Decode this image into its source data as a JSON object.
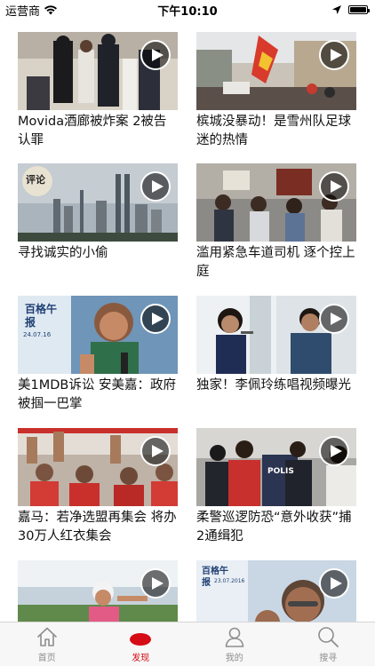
{
  "status_bar": {
    "carrier": "运营商",
    "time": "下午10:10",
    "battery_level": 1.0
  },
  "feed": {
    "items": [
      {
        "title": "Movida酒廊被炸案 2被告认罪",
        "icon": "play-icon"
      },
      {
        "title": "槟城没暴动！是雪州队足球迷的热情",
        "icon": "play-icon"
      },
      {
        "title": "寻找诚实的小偷",
        "icon": "play-icon",
        "thumb_badge": "评论"
      },
      {
        "title": "滥用紧急车道司机 逐个控上庭",
        "icon": "play-icon"
      },
      {
        "title": "美1MDB诉讼 安美嘉：政府被掴一巴掌",
        "icon": "play-icon",
        "thumb_badge": "百格午报",
        "thumb_date": "24.07.16"
      },
      {
        "title": "独家！李佩玲练唱视频曝光",
        "icon": "play-icon"
      },
      {
        "title": "嘉马：若净选盟再集会 将办30万人红衣集会",
        "icon": "play-icon"
      },
      {
        "title": "柔警巡逻防恐“意外收获”捕2通缉犯",
        "icon": "play-icon",
        "thumb_sign": "POLIS"
      },
      {
        "title": "",
        "icon": "play-icon"
      },
      {
        "title": "",
        "icon": "play-icon",
        "thumb_badge": "百格午报",
        "thumb_date": "23.07.2016"
      }
    ]
  },
  "tab_bar": {
    "tabs": [
      {
        "label": "首页",
        "icon": "home-icon",
        "active": false
      },
      {
        "label": "发现",
        "icon": "discover-icon",
        "active": true
      },
      {
        "label": "我的",
        "icon": "profile-icon",
        "active": false
      },
      {
        "label": "搜寻",
        "icon": "search-icon",
        "active": false
      }
    ]
  },
  "colors": {
    "accent": "#d50b16",
    "tab_inactive": "#8e8e8e",
    "tab_bar_bg": "#f7f7f7"
  }
}
